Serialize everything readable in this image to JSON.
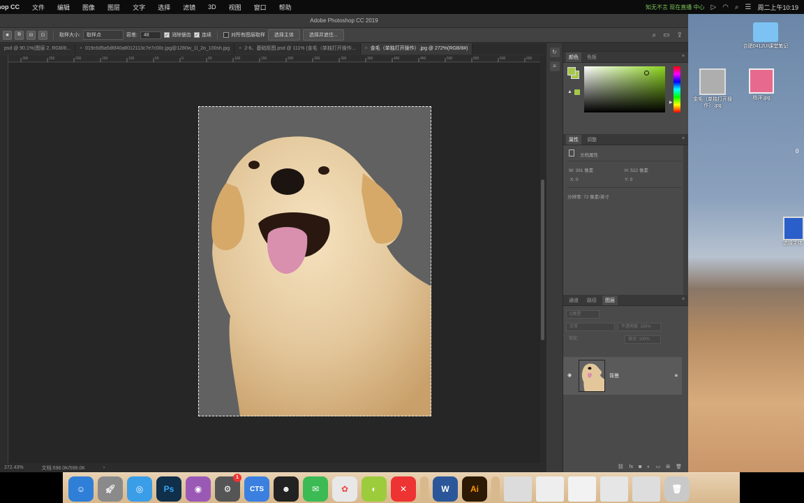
{
  "menubar": {
    "app": "hop CC",
    "items": [
      "文件",
      "编辑",
      "图像",
      "图层",
      "文字",
      "选择",
      "滤镜",
      "3D",
      "视图",
      "窗口",
      "帮助"
    ],
    "tray": "知无不言 现在直播 中心",
    "clock": "周二上午10:19"
  },
  "window": {
    "title": "Adobe Photoshop CC 2019"
  },
  "options": {
    "sample_size_label": "取样大小:",
    "sample_size_value": "取样点",
    "tolerance_label": "容差:",
    "tolerance_value": "48",
    "antialias_label": "消除锯齿",
    "contiguous_label": "连续",
    "all_layers_label": "对所有图层取样",
    "select_subject": "选择主体",
    "select_mask": "选择并遮住..."
  },
  "tabs": [
    {
      "label": "psd @ 90.1%(图层 2, RGB/8...",
      "active": false
    },
    {
      "label": "019c6d5a5d6f40a8012113c7e7c00c.jpg@1280w_1l_2o_100sh.jpg",
      "active": false
    },
    {
      "label": "2-6、基础抠图.psd @ 111% (金毛（单独打开操作...",
      "active": false
    },
    {
      "label": "金毛（单独打开操作）.jpg @ 272%(RGB/8#)",
      "active": true
    }
  ],
  "rulers": {
    "top": [
      "300",
      "250",
      "200",
      "150",
      "100",
      "50",
      "0",
      "50",
      "100",
      "150",
      "200",
      "250",
      "300",
      "350",
      "400",
      "450",
      "500",
      "550",
      "600",
      "650"
    ]
  },
  "status": {
    "zoom": "272.43%",
    "doc": "文档:598.0K/598.0K"
  },
  "color_panel": {
    "tabs": [
      "颜色",
      "色板"
    ],
    "fg_color": "#a6c84a"
  },
  "properties": {
    "tabs": [
      "属性",
      "调整"
    ],
    "title": "文档属性",
    "w": "W: 391 像素",
    "h": "H: 522 像素",
    "x": "X: 0",
    "y": "Y: 0",
    "resolution": "分辨率: 72 像素/英寸"
  },
  "layers": {
    "tabs": [
      "通道",
      "路径",
      "图层"
    ],
    "filter_kind": "Q类型",
    "blend_mode": "正常",
    "opacity": "不透明度: 100%",
    "lock_label": "锁定:",
    "fill": "填充: 100%",
    "layer_name": "背景"
  },
  "desktop": {
    "folder_label": "合肥0412UI课堂笔记",
    "dog_file_label": "金毛（单独打开操作）.jpg",
    "person_file_label": "杨洋.jpg",
    "edge_file_label": "选择主体",
    "edge_number": "0"
  },
  "dock": {
    "badge": "1",
    "labels": [
      "Ps",
      "CTS",
      "W",
      "Ai"
    ]
  },
  "colors": {
    "ps_bg": "#323232",
    "canvas_bg": "#262626",
    "accent_green": "#a6c84a",
    "dog_fur": "#e3c79b"
  }
}
